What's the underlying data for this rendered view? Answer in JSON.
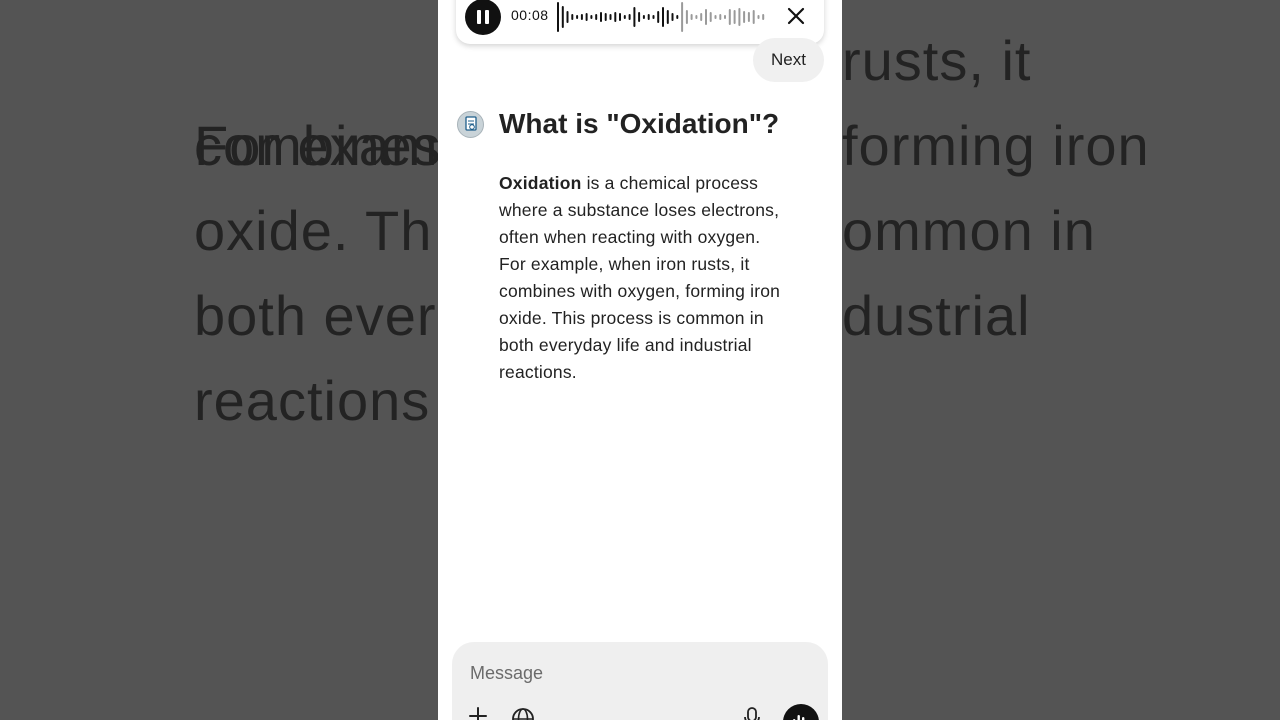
{
  "background": {
    "lines": [
      "For exam",
      "rusts, it",
      "combines",
      "forming iron",
      "oxide. Th",
      "ommon in",
      "both ever",
      "dustrial",
      "reactions"
    ]
  },
  "player": {
    "time": "00:08",
    "played_fraction": 0.58,
    "icons": {
      "pause": "pause-icon",
      "close": "close-icon"
    }
  },
  "next_label": "Next",
  "question": {
    "title": "What is \"Oxidation\"?",
    "answer_term": "Oxidation",
    "answer_lines": [
      "is a chemical process",
      "where a substance loses electrons,",
      "often when reacting with oxygen.",
      "For example, when iron rusts, it",
      "combines with oxygen, forming iron",
      "oxide. This process is common in",
      "both everyday life and industrial",
      "reactions."
    ]
  },
  "composer": {
    "placeholder": "Message",
    "icons": [
      "plus-icon",
      "globe-icon",
      "mic-icon",
      "voice-mode-icon"
    ]
  },
  "colors": {
    "background": "#545454",
    "screen": "#ffffff",
    "accent_dark": "#111111",
    "composer": "#efefef",
    "button_gray": "#f0f0f0"
  }
}
